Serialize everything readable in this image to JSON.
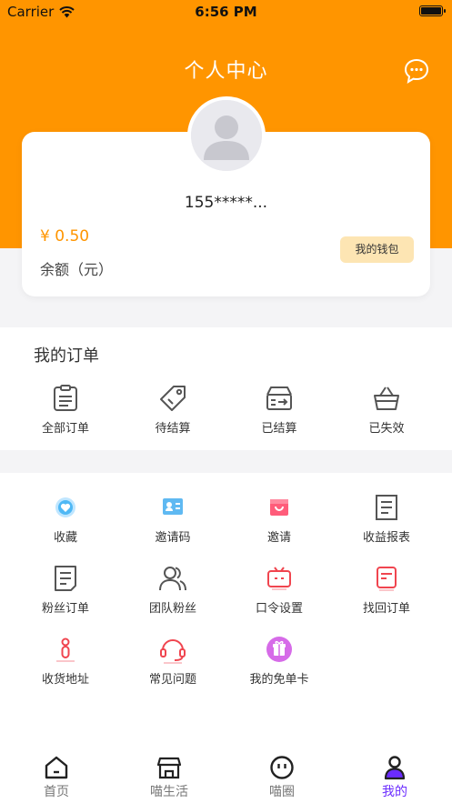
{
  "status_bar": {
    "carrier": "Carrier",
    "time": "6:56 PM"
  },
  "header": {
    "title": "个人中心"
  },
  "user": {
    "phone": "155*****...",
    "balance": "¥ 0.50",
    "balance_label": "余额（元）",
    "wallet_button": "我的钱包"
  },
  "orders": {
    "title": "我的订单",
    "items": [
      {
        "label": "全部订单",
        "icon": "clipboard-list-icon"
      },
      {
        "label": "待结算",
        "icon": "price-tag-icon"
      },
      {
        "label": "已结算",
        "icon": "settled-box-icon"
      },
      {
        "label": "已失效",
        "icon": "basket-icon"
      }
    ]
  },
  "tools": [
    {
      "label": "收藏",
      "icon": "heart-favorite-icon"
    },
    {
      "label": "邀请码",
      "icon": "id-card-icon"
    },
    {
      "label": "邀请",
      "icon": "gift-bag-icon"
    },
    {
      "label": "收益报表",
      "icon": "report-doc-icon"
    },
    {
      "label": "粉丝订单",
      "icon": "fans-order-doc-icon"
    },
    {
      "label": "团队粉丝",
      "icon": "team-users-icon"
    },
    {
      "label": "口令设置",
      "icon": "tv-settings-icon"
    },
    {
      "label": "找回订单",
      "icon": "retrieve-order-icon"
    },
    {
      "label": "收货地址",
      "icon": "location-pin-icon"
    },
    {
      "label": "常见问题",
      "icon": "headset-icon"
    },
    {
      "label": "我的免单卡",
      "icon": "free-card-icon"
    }
  ],
  "tabbar": {
    "active": "我的",
    "tabs": [
      {
        "label": "首页",
        "icon": "home-icon"
      },
      {
        "label": "喵生活",
        "icon": "store-icon"
      },
      {
        "label": "喵圈",
        "icon": "smile-circle-icon"
      },
      {
        "label": "我的",
        "icon": "profile-icon"
      }
    ]
  },
  "colors": {
    "accent": "#ff9500",
    "active_tab": "#6b2cff",
    "wallet_button_bg": "#fde5b3",
    "icon_red": "#f0454f",
    "icon_gray": "#555555"
  }
}
